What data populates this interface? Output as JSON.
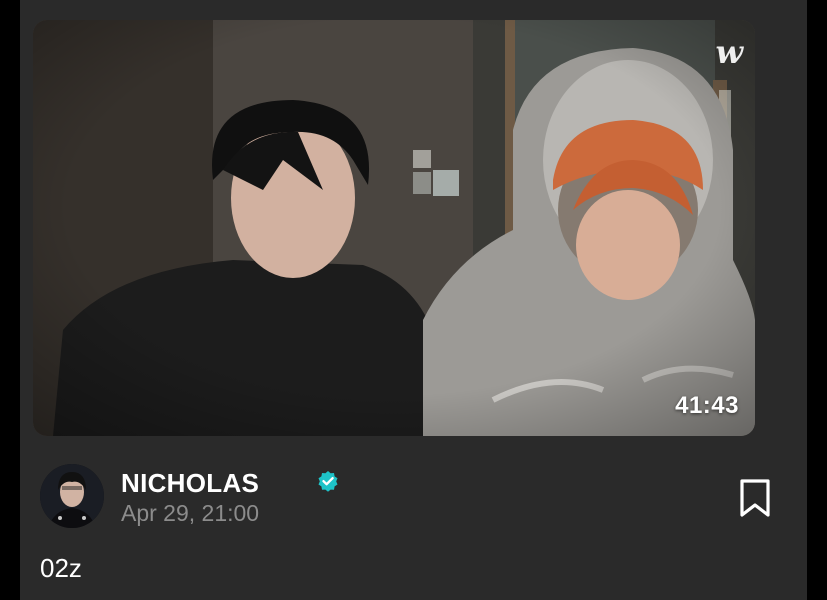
{
  "video": {
    "duration": "41:43",
    "platform_icon": "weverse-logo-icon",
    "logo_text": "w"
  },
  "author": {
    "name": "NICHOLAS",
    "verified_icon": "verified-badge-icon",
    "date": "Apr 29, 21:00"
  },
  "post": {
    "caption": "02z"
  },
  "actions": {
    "bookmark_icon": "bookmark-icon"
  },
  "colors": {
    "background": "#2a2a2a",
    "verified": "#1ec3c8",
    "muted_text": "#8c8c8c"
  }
}
